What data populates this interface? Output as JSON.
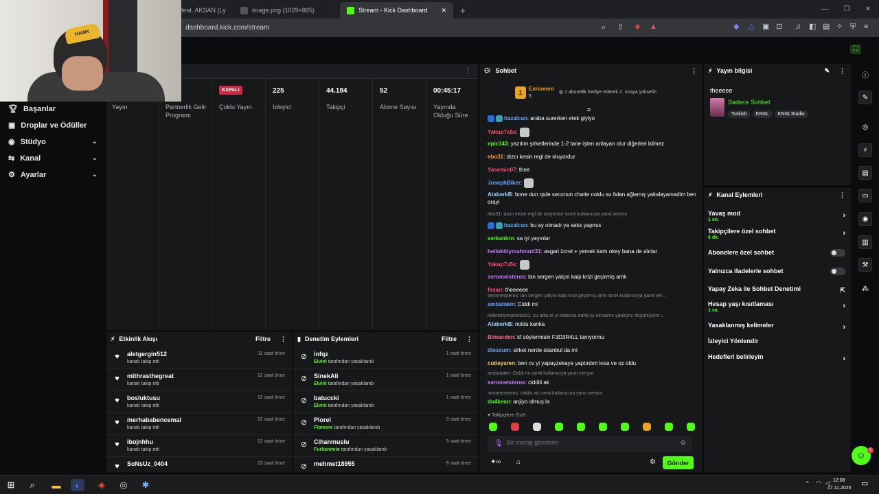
{
  "browser": {
    "tabs": [
      {
        "label": "feat. AKSAN (Ly"
      },
      {
        "label": "image.png (1029×885)"
      },
      {
        "label": "Stream - Kick Dashboard"
      }
    ],
    "url": "dashboard.kick.com/stream"
  },
  "sidebar": {
    "items": [
      {
        "label": "Başarılar"
      },
      {
        "label": "Droplar ve Ödüller"
      },
      {
        "label": "Stüdyo"
      },
      {
        "label": "Kanal"
      },
      {
        "label": "Ayarlar"
      }
    ]
  },
  "stats": {
    "cols": [
      {
        "value": "",
        "label": "Yayın"
      },
      {
        "value": "",
        "label": "Partnerlik Gelir Programı"
      },
      {
        "value": "KAPALI",
        "label": "Çoklu Yayın"
      },
      {
        "value": "225",
        "label": "İzleyici"
      },
      {
        "value": "44.184",
        "label": "Takipçi"
      },
      {
        "value": "52",
        "label": "Abone Sayısı"
      },
      {
        "value": "00:45:17",
        "label": "Yayında Olduğu Süre"
      }
    ]
  },
  "activity": {
    "title": "Etkinlik Akışı",
    "filter": "Filtre",
    "rows": [
      {
        "name": "aletgergin512",
        "action": "kanalı takip etti",
        "time": "11 saat önce"
      },
      {
        "name": "mithrasthegreat",
        "action": "kanalı takip etti",
        "time": "12 saat önce"
      },
      {
        "name": "bosluktusu",
        "action": "kanalı takip etti",
        "time": "12 saat önce"
      },
      {
        "name": "merhababencemal",
        "action": "kanalı takip etti",
        "time": "12 saat önce"
      },
      {
        "name": "ibojnhhu",
        "action": "kanalı takip etti",
        "time": "12 saat önce"
      },
      {
        "name": "SoNsUz_0404",
        "action": "",
        "time": "13 saat önce"
      }
    ]
  },
  "moderation": {
    "title": "Denetim Eylemleri",
    "filter": "Filtre",
    "rows": [
      {
        "name": "infqz",
        "by": "Elvinl",
        "action": "tarafından yasaklandı",
        "time": "1 saat önce"
      },
      {
        "name": "SinekAli",
        "by": "Elvinl",
        "action": "tarafından yasaklandı",
        "time": "1 saat önce"
      },
      {
        "name": "batuccki",
        "by": "Elvinl",
        "action": "tarafından yasaklandı",
        "time": "1 saat önce"
      },
      {
        "name": "Plorel",
        "by": "Flomore",
        "action": "tarafından yasaklandı",
        "time": "3 saat önce"
      },
      {
        "name": "Cihanmuslu",
        "by": "Furkanimio",
        "action": "tarafından yasaklandı",
        "time": "5 saat önce"
      },
      {
        "name": "mehmet18955",
        "by": "",
        "action": "",
        "time": "6 saat önce"
      }
    ]
  },
  "chat": {
    "title": "Sohbet",
    "pinned": {
      "user": "Exriomen",
      "count": "6",
      "text": "1 abonelik hediye ederek 2. sıraya yükselin"
    },
    "messages": [
      {
        "user": "hazalcan",
        "color": "#6aa8ff",
        "text": ": araba surerken etek giyiyo"
      },
      {
        "user": "Yakup7a5s",
        "color": "#ff4d6d",
        "text": ":"
      },
      {
        "user": "epic143",
        "color": "#53fc18",
        "text": ": yazılım şirketlerinde 1-2 tane işten anlayan olur diğerleri bilmez"
      },
      {
        "user": "ebo31",
        "color": "#ff9a3c",
        "text": ": dızcı kesin regl de oluyordur"
      },
      {
        "user": "Yasemin07",
        "color": "#ff4d6d",
        "text": ": thee"
      },
      {
        "user": "JosephBiker",
        "color": "#6aa8ff",
        "text": ":"
      },
      {
        "user": "AtaberkB",
        "color": "#9fd3ff",
        "text": ": bone dun rpde seconun chatte noldu su falan ağlamış yakalayamadim ben orayi"
      },
      {
        "user": "hazalcan",
        "color": "#6aa8ff",
        "text": ": bu ay olmadı ya seks yapmıs"
      },
      {
        "user": "serkankrn",
        "color": "#53fc18",
        "text": ": sa iyi yayınlar"
      },
      {
        "user": "hellokittymahmutt31",
        "color": "#c77dff",
        "text": ": asgari ücret + yemek kartı okey bana de alırlar"
      },
      {
        "user": "Yakup7a5s",
        "color": "#ff4d6d",
        "text": ":"
      },
      {
        "user": "seromeisteros",
        "color": "#c77dff",
        "text": ": lan sergen yalçın kalp krizi geçirmiş amk"
      },
      {
        "user": "fasarı",
        "color": "#ff4d6d",
        "text": ": theeeeee"
      },
      {
        "user": "ambatakm",
        "color": "#6aa8ff",
        "text": ": Ciddi mi"
      },
      {
        "user": "AtaberkB",
        "color": "#9fd3ff",
        "text": ": noldu kanka"
      },
      {
        "user": "Bitwarden",
        "color": "#ff6b8a",
        "text": ": kf söylermisin F3D3R4LL tanıyormu"
      },
      {
        "user": "dioscum",
        "color": "#6aa8ff",
        "text": ": sirket nerde istanbul da mi"
      },
      {
        "user": "cutieyaren",
        "color": "#ffd166",
        "text": ": ben cv yi yapayzekaya yaptırdım kısa ve oz oldu"
      },
      {
        "user": "seromeisteros",
        "color": "#c77dff",
        "text": ": ciddiii ak"
      },
      {
        "user": "dn4kenn",
        "color": "#53fc18",
        "text": ": anjiyo olmuş la"
      }
    ],
    "replies": [
      "ebo31: dızcı kesin regl de oluyordur isimli kullanıcıya yanıt veriyor",
      "seromeisteros: lan sergen yalçın kalp krizi geçirmiş amk isimli kullanıcıya yanıt ver...",
      "hellokittymahmutt31: su abla st yi kaldırsa daha iyi olmazmı yanlışmı düşünüyom i...",
      "ambatakm: Ciddi mi isimli kullanıcıya yanıt veriyor",
      "seromeisteros: ciddiii ak isimli kullanıcıya yanıt veriyor"
    ],
    "followers_only": "Takipçilere Özel",
    "input_placeholder": "Bir mesaj gönderin",
    "send": "Gönder"
  },
  "stream_info": {
    "title": "Yayın bilgisi",
    "stream_title": "theeeee",
    "category": "Sadece Sohbet",
    "tags": [
      "Turkish",
      "KNGL",
      "KNGLStudio"
    ]
  },
  "channel_actions": {
    "title": "Kanal Eylemleri",
    "items": [
      {
        "label": "Yavaş mod",
        "sub": "1 sn."
      },
      {
        "label": "Takipçilere özel sohbet",
        "sub": "6 dk."
      },
      {
        "label": "Abonelere özel sohbet",
        "sub": ""
      },
      {
        "label": "Yalnızca ifadelerle sohbet",
        "sub": ""
      },
      {
        "label": "Yapay Zeka ile Sohbet Denetimi",
        "sub": ""
      },
      {
        "label": "Hesap yaşı kısıtlaması",
        "sub": "1 sa."
      },
      {
        "label": "Yasaklanmış kelimeler",
        "sub": ""
      },
      {
        "label": "İzleyici Yönlendir",
        "sub": ""
      },
      {
        "label": "Hedefleri belirleyin",
        "sub": ""
      }
    ]
  },
  "taskbar": {
    "time": "12:08",
    "date": "17.11.2025"
  },
  "notif_count": "1",
  "colors": {
    "accent": "#53fc18",
    "bg": "#0b0c0e",
    "panel": "#17181a"
  }
}
